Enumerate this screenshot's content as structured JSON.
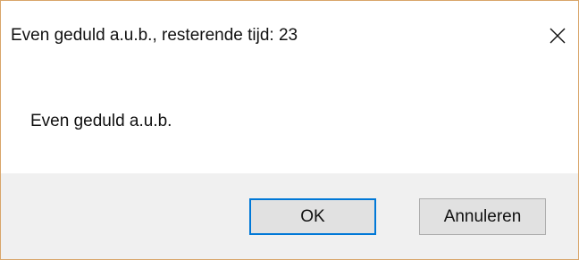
{
  "window": {
    "title": "Even geduld a.u.b., resterende tijd: 23",
    "close_icon": "close-icon"
  },
  "content": {
    "message": "Even geduld a.u.b."
  },
  "buttons": {
    "ok_label": "OK",
    "cancel_label": "Annuleren"
  },
  "colors": {
    "border": "#d9a66a",
    "footer_background": "#f0f0f0",
    "default_button_border": "#0078d7",
    "button_background": "#e1e1e1"
  }
}
